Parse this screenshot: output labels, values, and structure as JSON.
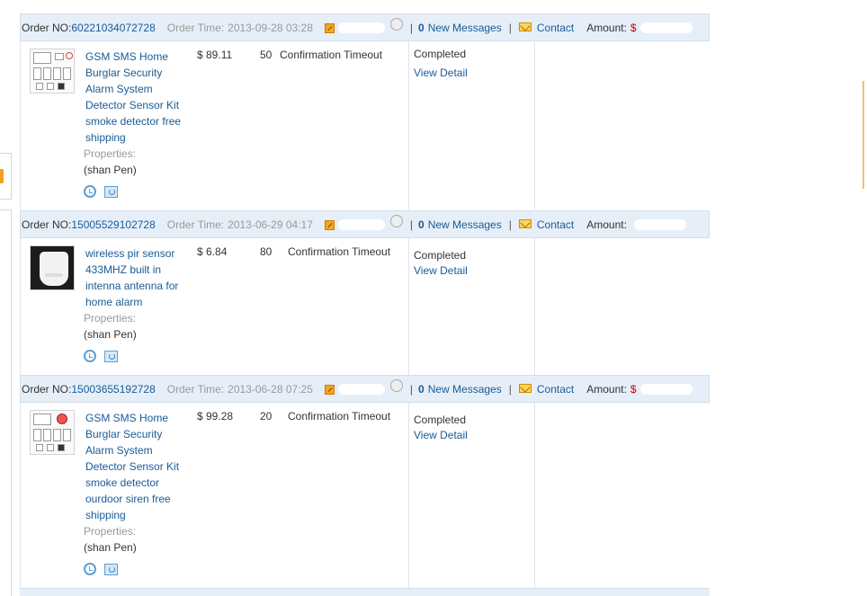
{
  "labels": {
    "order_no": "Order NO:",
    "order_time": "Order Time:",
    "new_messages": "New Messages",
    "contact": "Contact",
    "amount": "Amount:",
    "separator": "|",
    "properties": "Properties:",
    "view_detail": "View Detail"
  },
  "orders": [
    {
      "order_no": "60221034072728",
      "order_time": "2013-09-28 03:28",
      "message_count": "0",
      "amount_currency": "$",
      "product_title": "GSM SMS Home Burglar Security Alarm System Detector Sensor Kit smoke detector free shipping",
      "price": "$ 89.11",
      "quantity": "50",
      "confirm_status": "Confirmation Timeout",
      "property_value": "(shan Pen)",
      "order_status": "Completed"
    },
    {
      "order_no": "15005529102728",
      "order_time": "2013-06-29 04:17",
      "message_count": "0",
      "amount_currency": "",
      "product_title": "wireless pir sensor 433MHZ built in intenna antenna for home alarm",
      "price": "$ 6.84",
      "quantity": "80",
      "confirm_status": "Confirmation Timeout",
      "property_value": "(shan Pen)",
      "order_status": "Completed"
    },
    {
      "order_no": "15003655192728",
      "order_time": "2013-06-28 07:25",
      "message_count": "0",
      "amount_currency": "$",
      "product_title": "GSM SMS Home Burglar Security Alarm System Detector Sensor Kit smoke detector ourdoor siren free shipping",
      "price": "$ 99.28",
      "quantity": "20",
      "confirm_status": "Confirmation Timeout",
      "property_value": "(shan Pen)",
      "order_status": "Completed"
    }
  ],
  "colors": {
    "header_bg": "#e6eff8",
    "link": "#1a5b96",
    "amount_currency": "#cc0000",
    "muted": "#999999"
  },
  "icons": [
    "memo-icon",
    "buyer-face-icon",
    "envelope-icon",
    "alarm-clock-icon",
    "refresh-icon"
  ]
}
